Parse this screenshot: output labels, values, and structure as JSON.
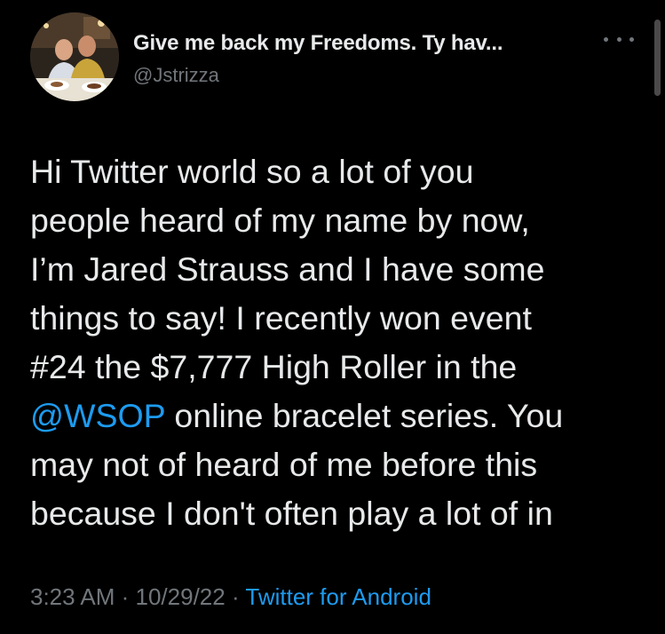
{
  "author": {
    "display_name": "Give me back my Freedoms. Ty hav...",
    "handle": "@Jstrizza"
  },
  "tweet": {
    "lines": [
      {
        "text": "Hi Twitter world so a lot of you"
      },
      {
        "text": "people heard of my name by now,"
      },
      {
        "text": "I’m Jared Strauss and I have some"
      },
      {
        "text": "things to say! I recently won event"
      },
      {
        "text": "#24 the $7,777 High Roller in the"
      },
      {
        "mention": "@WSOP",
        "text": " online bracelet series. You"
      },
      {
        "text": "may not of heard of me before this"
      },
      {
        "text": "because I don't often play a lot of in"
      }
    ],
    "time": "3:23 AM",
    "separator": " · ",
    "date": "10/29/22",
    "source": "Twitter for Android"
  },
  "icons": {
    "more": "more-options-icon",
    "avatar": "profile-photo"
  },
  "colors": {
    "background": "#000000",
    "text": "#e7e9ea",
    "muted": "#71767b",
    "link": "#1d9bf0"
  }
}
